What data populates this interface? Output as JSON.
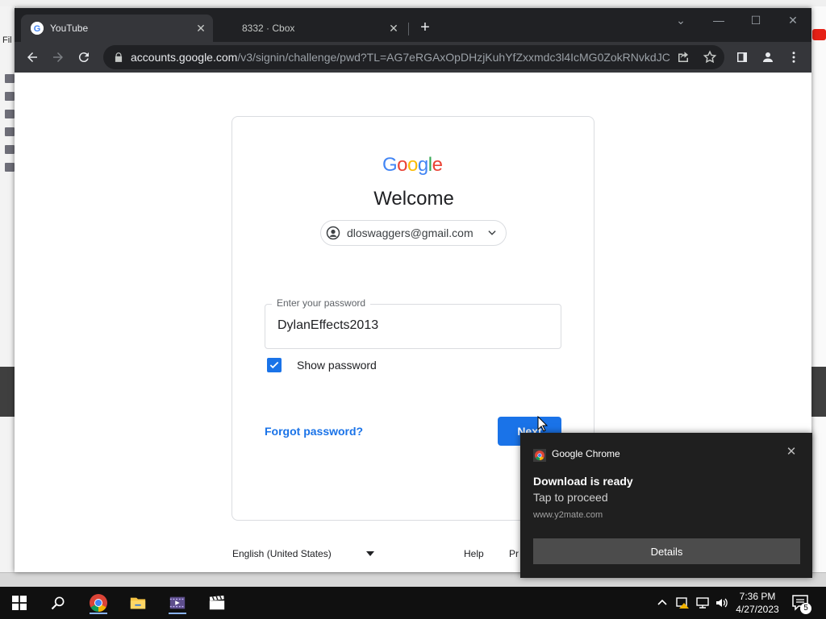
{
  "browser": {
    "tabs": [
      {
        "title": "YouTube"
      },
      {
        "title": "8332 · Cbox"
      }
    ],
    "url_domain": "accounts.google.com",
    "url_path": "/v3/signin/challenge/pwd?TL=AG7eRGAxOpDHzjKuhYfZxxmdc3l4IcMG0ZokRNvkdJC..."
  },
  "background": {
    "file_menu": "Fil"
  },
  "signin": {
    "logo_letters": [
      "G",
      "o",
      "o",
      "g",
      "l",
      "e"
    ],
    "logo_colors": [
      "#4285f4",
      "#ea4335",
      "#fbbc05",
      "#4285f4",
      "#34a853",
      "#ea4335"
    ],
    "welcome": "Welcome",
    "email": "dloswaggers@gmail.com",
    "password_label": "Enter your password",
    "password_value": "DylanEffects2013",
    "show_password_label": "Show password",
    "forgot_password": "Forgot password?",
    "next_button": "Next",
    "footer_language": "English (United States)",
    "footer_help": "Help",
    "footer_privacy": "Pr"
  },
  "notification": {
    "app_name": "Google Chrome",
    "title": "Download is ready",
    "body": "Tap to proceed",
    "source": "www.y2mate.com",
    "details_button": "Details"
  },
  "taskbar": {
    "time": "7:36 PM",
    "date": "4/27/2023",
    "notification_count": "5"
  },
  "colors": {
    "accent_blue": "#1a73e8",
    "chrome_dark": "#202124",
    "toast_bg": "#1f1f1f"
  }
}
